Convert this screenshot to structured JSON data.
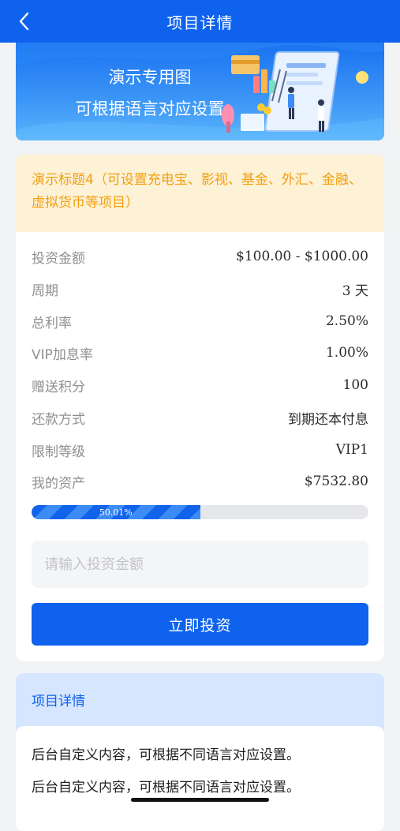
{
  "nav": {
    "title": "项目详情",
    "back_icon": "chevron-left-icon"
  },
  "banner": {
    "line1": "演示专用图",
    "line2": "可根据语言对应设置"
  },
  "project": {
    "title": "演示标题4（可设置充电宝、影视、基金、外汇、金融、虚拟货币等项目）",
    "rows": [
      {
        "label": "投资金额",
        "value": "$100.00 - $1000.00"
      },
      {
        "label": "周期",
        "value": "3 天"
      },
      {
        "label": "总利率",
        "value": "2.50%"
      },
      {
        "label": "VIP加息率",
        "value": "1.00%"
      },
      {
        "label": "赠送积分",
        "value": "100"
      },
      {
        "label": "还款方式",
        "value": "到期还本付息"
      },
      {
        "label": "限制等级",
        "value": "VIP1"
      },
      {
        "label": "我的资产",
        "value": "$7532.80"
      }
    ],
    "progress": {
      "label": "50.01%",
      "value": 0.5001
    },
    "amount_input": {
      "placeholder": "请输入投资金额",
      "value": ""
    },
    "invest_button": "立即投资"
  },
  "detail": {
    "header": "项目详情",
    "lines": [
      "后台自定义内容，可根据不同语言对应设置。",
      "后台自定义内容，可根据不同语言对应设置。"
    ]
  },
  "colors": {
    "primary": "#0e62ee",
    "title_accent": "#f2a010",
    "title_bg": "#fdf1d6",
    "detail_bg": "#d6e6ff"
  }
}
